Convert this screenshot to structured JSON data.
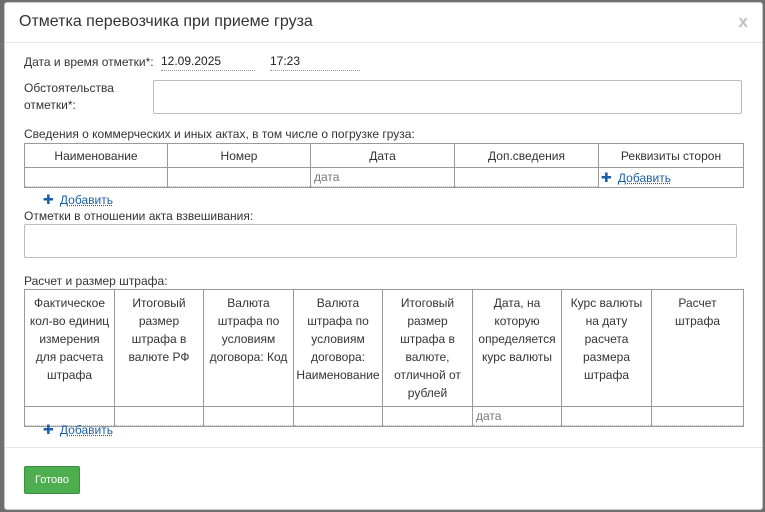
{
  "dialog": {
    "title": "Отметка перевозчика при приеме груза",
    "close_label": "x"
  },
  "form": {
    "datetime_label": "Дата и время отметки*:",
    "date_value": "12.09.2025",
    "time_value": "17:23",
    "circumstances_label_line1": "Обстоятельства",
    "circumstances_label_line2": "отметки*:",
    "acts_label": "Сведения о коммерческих и иных актах, в том числе о погрузке груза:",
    "weighing_label": "Отметки в отношении акта взвешивания:",
    "fine_label": "Расчет и размер штрафа:"
  },
  "acts_table": {
    "headers": [
      "Наименование",
      "Номер",
      "Дата",
      "Доп.сведения",
      "Реквизиты сторон"
    ],
    "date_placeholder": "дата",
    "row_add_label": "Добавить"
  },
  "acts_add_label": "Добавить",
  "fine_table": {
    "headers": [
      "Фактическое кол-во единиц измерения для расчета штрафа",
      "Итоговый размер штрафа в валюте РФ",
      "Валюта штрафа по условиям договора: Код",
      "Валюта штрафа по условиям договора: Наименование",
      "Итоговый размер штрафа в валюте, отличной от рублей",
      "Дата, на которую определяется курс валюты",
      "Курс валюты на дату расчета размера штрафа",
      "Расчет штрафа"
    ],
    "date_placeholder": "дата"
  },
  "fine_add_label": "Добавить",
  "footer": {
    "done_label": "Готово"
  },
  "colors": {
    "accent_link": "#1a5fa8",
    "done_button": "#4cae4c"
  }
}
